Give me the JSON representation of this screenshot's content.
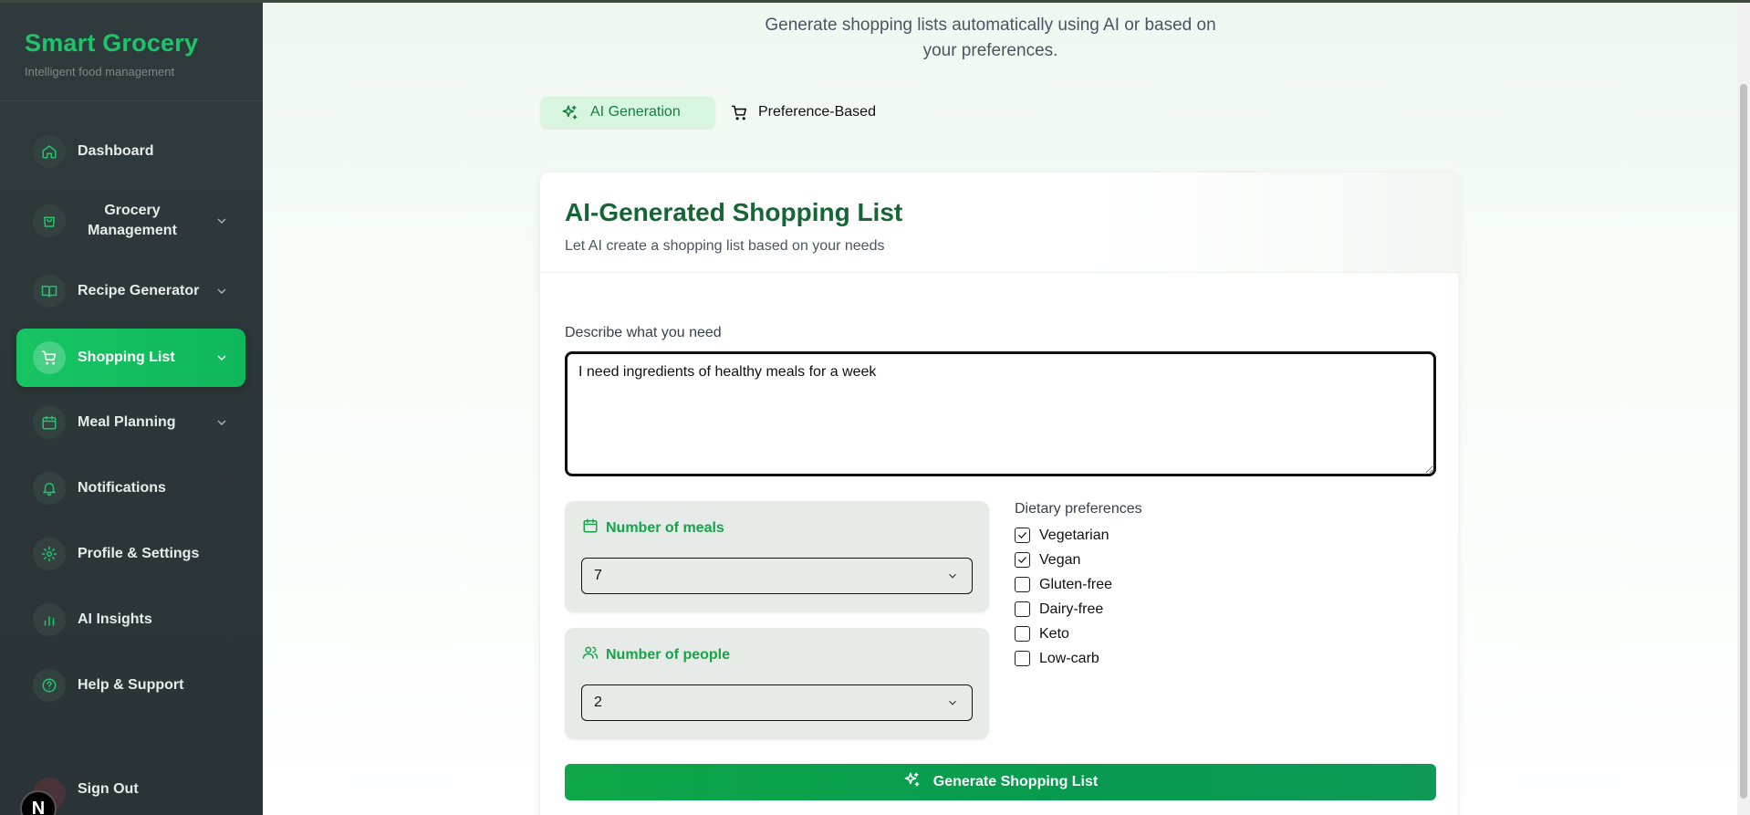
{
  "app": {
    "title": "Smart Grocery",
    "subtitle": "Intelligent food management"
  },
  "sidebar": {
    "items": [
      {
        "label": "Dashboard",
        "icon": "home-icon",
        "has_chevron": false,
        "active": false
      },
      {
        "label": "Grocery Management",
        "icon": "shopping-bag-icon",
        "has_chevron": true,
        "active": false
      },
      {
        "label": "Recipe Generator",
        "icon": "book-icon",
        "has_chevron": true,
        "active": false
      },
      {
        "label": "Shopping List",
        "icon": "shopping-cart-icon",
        "has_chevron": true,
        "active": true
      },
      {
        "label": "Meal Planning",
        "icon": "calendar-icon",
        "has_chevron": true,
        "active": false
      },
      {
        "label": "Notifications",
        "icon": "bell-icon",
        "has_chevron": false,
        "active": false
      },
      {
        "label": "Profile & Settings",
        "icon": "gear-icon",
        "has_chevron": false,
        "active": false
      },
      {
        "label": "AI Insights",
        "icon": "bar-chart-icon",
        "has_chevron": false,
        "active": false
      },
      {
        "label": "Help & Support",
        "icon": "help-circle-icon",
        "has_chevron": false,
        "active": false
      }
    ],
    "signout_label": "Sign Out",
    "badge_letter": "N"
  },
  "main": {
    "subtitle": "Generate shopping lists automatically using AI or based on your preferences.",
    "tabs": [
      {
        "label": "AI Generation",
        "icon": "sparkles-icon",
        "active": true
      },
      {
        "label": "Preference-Based",
        "icon": "shopping-cart-icon",
        "active": false
      }
    ],
    "card": {
      "title": "AI-Generated Shopping List",
      "description": "Let AI create a shopping list based on your needs",
      "describe_label": "Describe what you need",
      "describe_value": "I need ingredients of healthy meals for a week",
      "meals": {
        "label": "Number of meals",
        "value": "7",
        "icon": "calendar-icon"
      },
      "people": {
        "label": "Number of people",
        "value": "2",
        "icon": "users-icon"
      },
      "dietary": {
        "title": "Dietary preferences",
        "options": [
          {
            "label": "Vegetarian",
            "checked": true
          },
          {
            "label": "Vegan",
            "checked": true
          },
          {
            "label": "Gluten-free",
            "checked": false
          },
          {
            "label": "Dairy-free",
            "checked": false
          },
          {
            "label": "Keto",
            "checked": false
          },
          {
            "label": "Low-carb",
            "checked": false
          }
        ]
      },
      "generate_label": "Generate Shopping List"
    }
  },
  "colors": {
    "accent": "#16c463",
    "brand": "#1ec46a",
    "sidebar_bg": "#2f3a3d",
    "title_green": "#166534",
    "button_green": "#079a4f"
  }
}
